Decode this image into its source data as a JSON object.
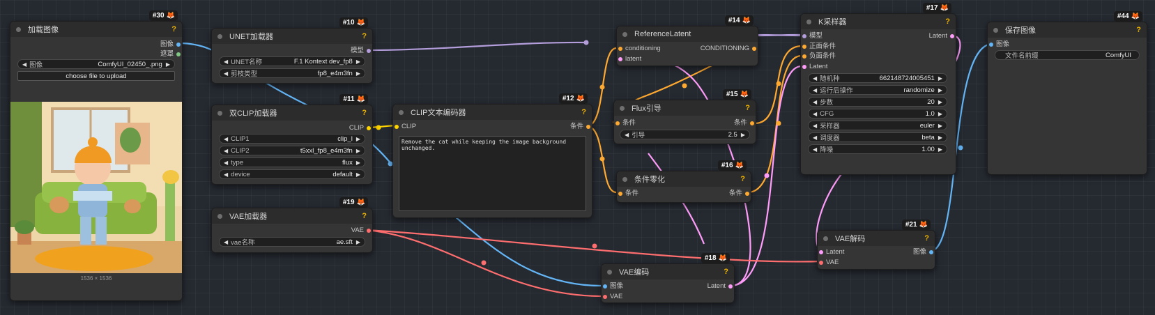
{
  "colors": {
    "model": "#b39ddb",
    "clip": "#ffd500",
    "conditioning": "#ffa931",
    "latent": "#ff9cf9",
    "vae": "#ff6e6e",
    "image": "#64b5f6",
    "mask": "#81c784",
    "help": "#f0b400",
    "fox": "#ff7a1a"
  },
  "nodes": {
    "load_image": {
      "badge": "#30",
      "title": "加载图像",
      "help": "?",
      "outputs": [
        "图像",
        "遮罩"
      ],
      "widgets": [
        {
          "label": "图像",
          "value": "ComfyUI_02450_.png"
        }
      ],
      "upload_label": "choose file to upload",
      "size_caption": "1536 × 1536"
    },
    "unet": {
      "badge": "#10",
      "title": "UNET加载器",
      "help": "?",
      "outputs": [
        "模型"
      ],
      "widgets": [
        {
          "label": "UNET名称",
          "value": "F.1 Kontext dev_fp8"
        },
        {
          "label": "剪枝类型",
          "value": "fp8_e4m3fn"
        }
      ]
    },
    "dual_clip": {
      "badge": "#11",
      "title": "双CLIP加载器",
      "help": "?",
      "outputs": [
        "CLIP"
      ],
      "widgets": [
        {
          "label": "CLIP1",
          "value": "clip_l"
        },
        {
          "label": "CLIP2",
          "value": "t5xxl_fp8_e4m3fn"
        },
        {
          "label": "type",
          "value": "flux"
        },
        {
          "label": "device",
          "value": "default"
        }
      ]
    },
    "vae_loader": {
      "badge": "#19",
      "title": "VAE加载器",
      "help": "?",
      "outputs": [
        "VAE"
      ],
      "widgets": [
        {
          "label": "vae名称",
          "value": "ae.sft"
        }
      ]
    },
    "clip_encode": {
      "badge": "#12",
      "title": "CLIP文本编码器",
      "help": "?",
      "inputs": [
        "CLIP"
      ],
      "outputs": [
        "条件"
      ],
      "text": "Remove the cat while keeping the image background unchanged."
    },
    "ref_latent": {
      "badge": "#14",
      "title": "ReferenceLatent",
      "inputs": [
        "conditioning",
        "latent"
      ],
      "outputs": [
        "CONDITIONING"
      ]
    },
    "flux_guidance": {
      "badge": "#15",
      "title": "Flux引导",
      "help": "?",
      "inputs": [
        "条件"
      ],
      "outputs": [
        "条件"
      ],
      "widgets": [
        {
          "label": "引导",
          "value": "2.5"
        }
      ]
    },
    "cond_zero": {
      "badge": "#16",
      "title": "条件零化",
      "help": "?",
      "inputs": [
        "条件"
      ],
      "outputs": [
        "条件"
      ]
    },
    "vae_encode": {
      "badge": "#18",
      "title": "VAE编码",
      "help": "?",
      "inputs": [
        "图像",
        "VAE"
      ],
      "outputs": [
        "Latent"
      ]
    },
    "ksampler": {
      "badge": "#17",
      "title": "K采样器",
      "help": "?",
      "inputs": [
        "模型",
        "正面条件",
        "负面条件",
        "Latent"
      ],
      "outputs": [
        "Latent"
      ],
      "widgets": [
        {
          "label": "随机种",
          "value": "662148724005451"
        },
        {
          "label": "运行后操作",
          "value": "randomize"
        },
        {
          "label": "步数",
          "value": "20"
        },
        {
          "label": "CFG",
          "value": "1.0"
        },
        {
          "label": "采样器",
          "value": "euler"
        },
        {
          "label": "调度器",
          "value": "beta"
        },
        {
          "label": "降噪",
          "value": "1.00"
        }
      ]
    },
    "vae_decode": {
      "badge": "#21",
      "title": "VAE解码",
      "help": "?",
      "inputs": [
        "Latent",
        "VAE"
      ],
      "outputs": [
        "图像"
      ]
    },
    "save_image": {
      "badge": "#44",
      "title": "保存图像",
      "help": "?",
      "inputs": [
        "图像"
      ],
      "widgets": [
        {
          "label": "文件名前缀",
          "value": "ComfyUI"
        }
      ]
    }
  }
}
